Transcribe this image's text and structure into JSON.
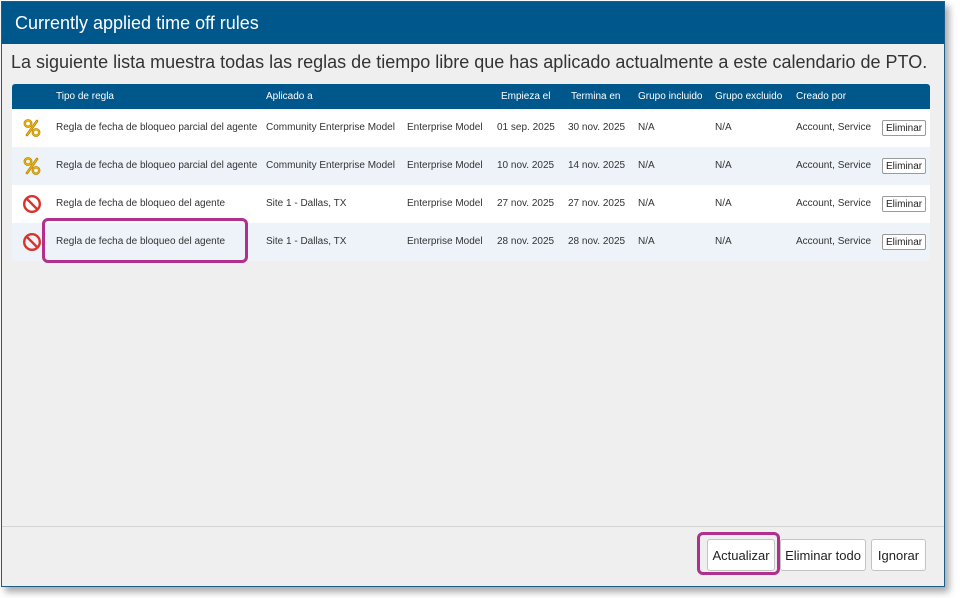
{
  "dialog": {
    "title": "Currently applied time off rules",
    "intro": "La siguiente lista muestra todas las reglas de tiempo libre que has aplicado actualmente a este calendario de PTO."
  },
  "table": {
    "headers": {
      "rule_type": "Tipo de regla",
      "applied_to": "Aplicado a",
      "starts": "Empieza el",
      "ends": "Termina en",
      "included_group": "Grupo incluido",
      "excluded_group": "Grupo excluido",
      "created_by": "Creado por"
    },
    "rows": [
      {
        "icon": "percent-icon",
        "rule_type": "Regla de fecha de bloqueo parcial del agente",
        "applied_to": "Community Enterprise Model",
        "scope": "Enterprise Model",
        "starts": "01 sep. 2025",
        "ends": "30 nov. 2025",
        "included_group": "N/A",
        "excluded_group": "N/A",
        "created_by": "Account, Service",
        "delete_label": "Eliminar"
      },
      {
        "icon": "percent-icon",
        "rule_type": "Regla de fecha de bloqueo parcial del agente",
        "applied_to": "Community Enterprise Model",
        "scope": "Enterprise Model",
        "starts": "10 nov. 2025",
        "ends": "14 nov. 2025",
        "included_group": "N/A",
        "excluded_group": "N/A",
        "created_by": "Account, Service",
        "delete_label": "Eliminar"
      },
      {
        "icon": "blocked-icon",
        "rule_type": "Regla de fecha de bloqueo del agente",
        "applied_to": "Site 1 - Dallas, TX",
        "scope": "Enterprise Model",
        "starts": "27 nov. 2025",
        "ends": "27 nov. 2025",
        "included_group": "N/A",
        "excluded_group": "N/A",
        "created_by": "Account, Service",
        "delete_label": "Eliminar"
      },
      {
        "icon": "blocked-icon",
        "rule_type": "Regla de fecha de bloqueo del agente",
        "applied_to": "Site 1 - Dallas, TX",
        "scope": "Enterprise Model",
        "starts": "28 nov. 2025",
        "ends": "28 nov. 2025",
        "included_group": "N/A",
        "excluded_group": "N/A",
        "created_by": "Account, Service",
        "delete_label": "Eliminar"
      }
    ]
  },
  "footer": {
    "update_label": "Actualizar",
    "delete_all_label": "Eliminar todo",
    "ignore_label": "Ignorar"
  },
  "colors": {
    "header_bg": "#00578b",
    "highlight": "#b0308e",
    "blocked_red": "#d9342b",
    "percent_yellow": "#f2b600"
  }
}
